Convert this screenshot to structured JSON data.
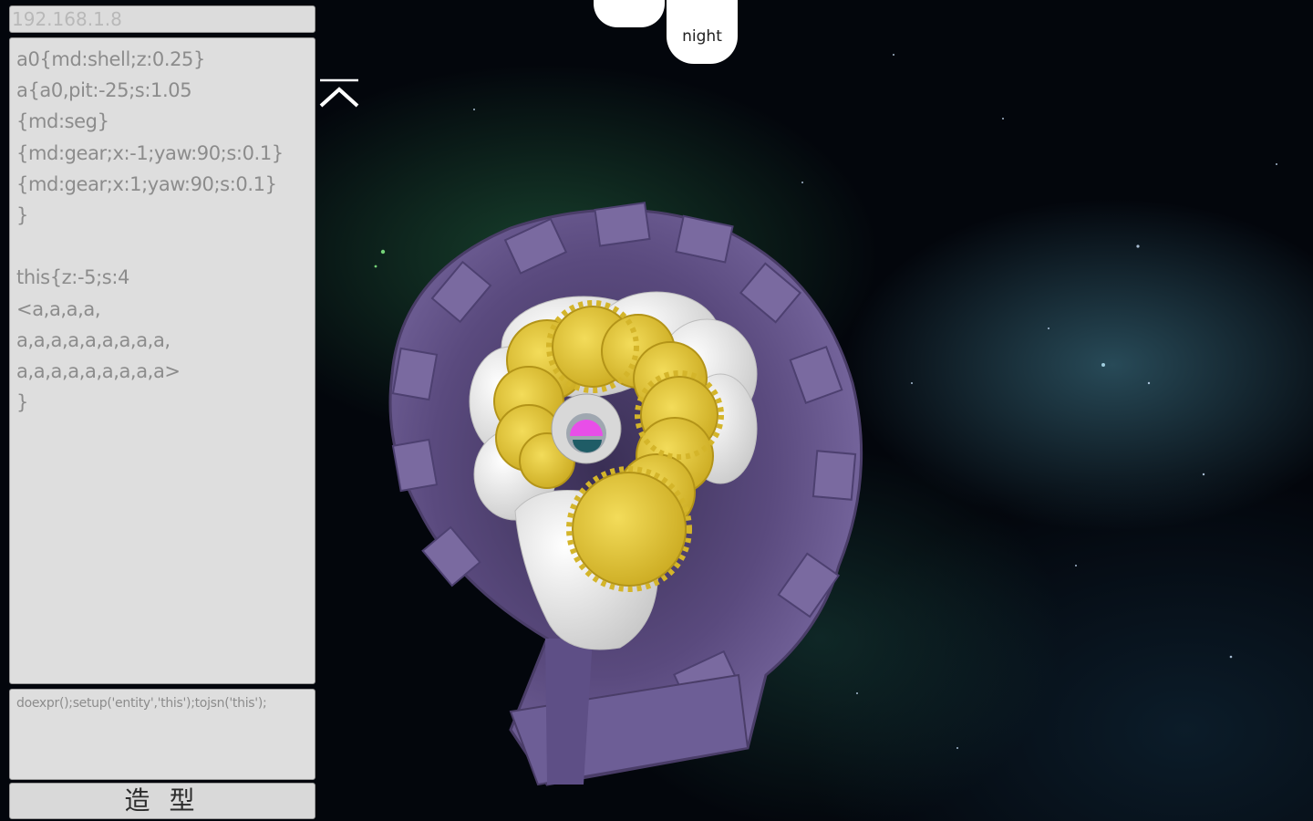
{
  "ip_field": {
    "value": "192.168.1.8"
  },
  "editor": {
    "code": "a0{md:shell;z:0.25}\na{a0,pit:-25;s:1.05\n{md:seg}\n{md:gear;x:-1;yaw:90;s:0.1}\n{md:gear;x:1;yaw:90;s:0.1}\n}\n\nthis{z:-5;s:4\n<a,a,a,a,\na,a,a,a,a,a,a,a,a,\na,a,a,a,a,a,a,a,a>\n}"
  },
  "command": {
    "value": "doexpr();setup('entity','this');tojsn('this');"
  },
  "model_button": {
    "label": "造 型"
  },
  "top_buttons": {
    "night_label": "night"
  },
  "icons": {
    "collapse": "chevron-up-icon"
  },
  "colors": {
    "panel_bg": "#dedede",
    "panel_text": "#8c8c8c",
    "shell": "#6a5a8e",
    "gear": "#e6c83a",
    "segment": "#f2f2f2",
    "marker": "#e84ee8"
  }
}
